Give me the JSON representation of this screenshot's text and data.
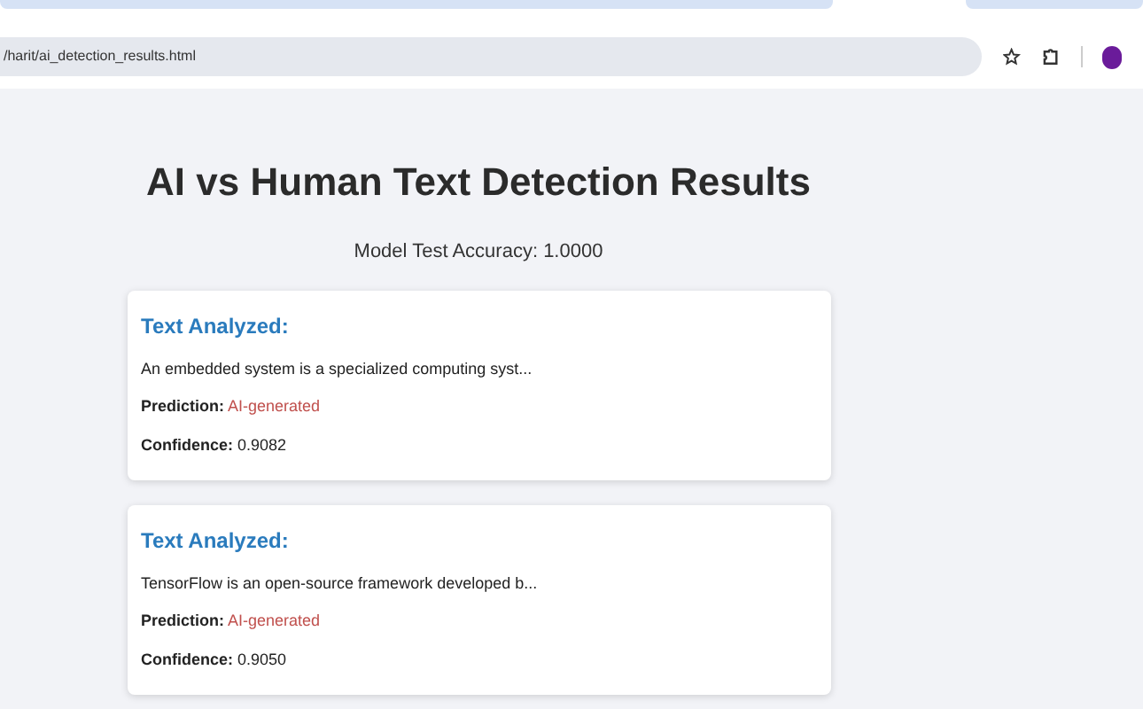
{
  "browser": {
    "url": "/harit/ai_detection_results.html"
  },
  "page": {
    "title": "AI vs Human Text Detection Results",
    "accuracy": "Model Test Accuracy: 1.0000",
    "results": [
      {
        "heading": "Text Analyzed:",
        "text": "An embedded system is a specialized computing syst...",
        "prediction_label": "Prediction:",
        "prediction": "AI-generated",
        "kind": "ai",
        "confidence_label": "Confidence:",
        "confidence": "0.9082"
      },
      {
        "heading": "Text Analyzed:",
        "text": "TensorFlow is an open-source framework developed b...",
        "prediction_label": "Prediction:",
        "prediction": "AI-generated",
        "kind": "ai",
        "confidence_label": "Confidence:",
        "confidence": "0.9050"
      }
    ]
  }
}
